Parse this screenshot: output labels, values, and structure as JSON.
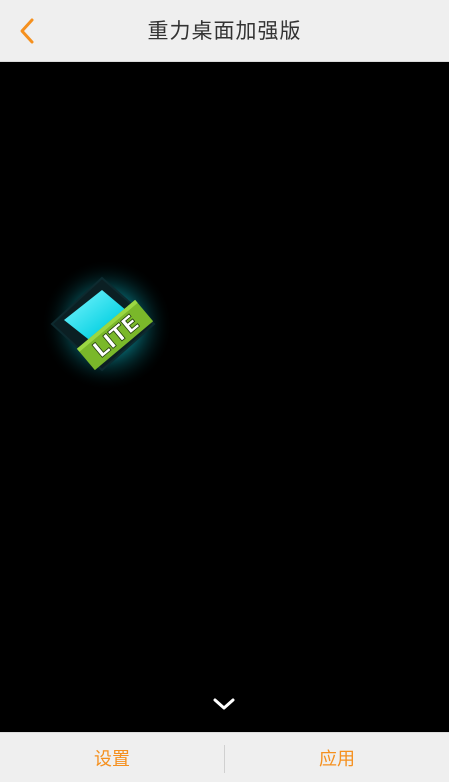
{
  "header": {
    "title": "重力桌面加强版",
    "back_icon": "chevron-left-icon"
  },
  "preview": {
    "app_icon": {
      "name": "gravity-desktop-lite-icon",
      "badge_text": "LITE"
    },
    "expand_icon": "chevron-down-icon"
  },
  "bottom_bar": {
    "settings_label": "设置",
    "apply_label": "应用"
  },
  "colors": {
    "accent": "#f5901e",
    "header_bg": "#efefef",
    "preview_bg": "#000000",
    "icon_cyan": "#19e3f0",
    "icon_green": "#7ab82a"
  }
}
